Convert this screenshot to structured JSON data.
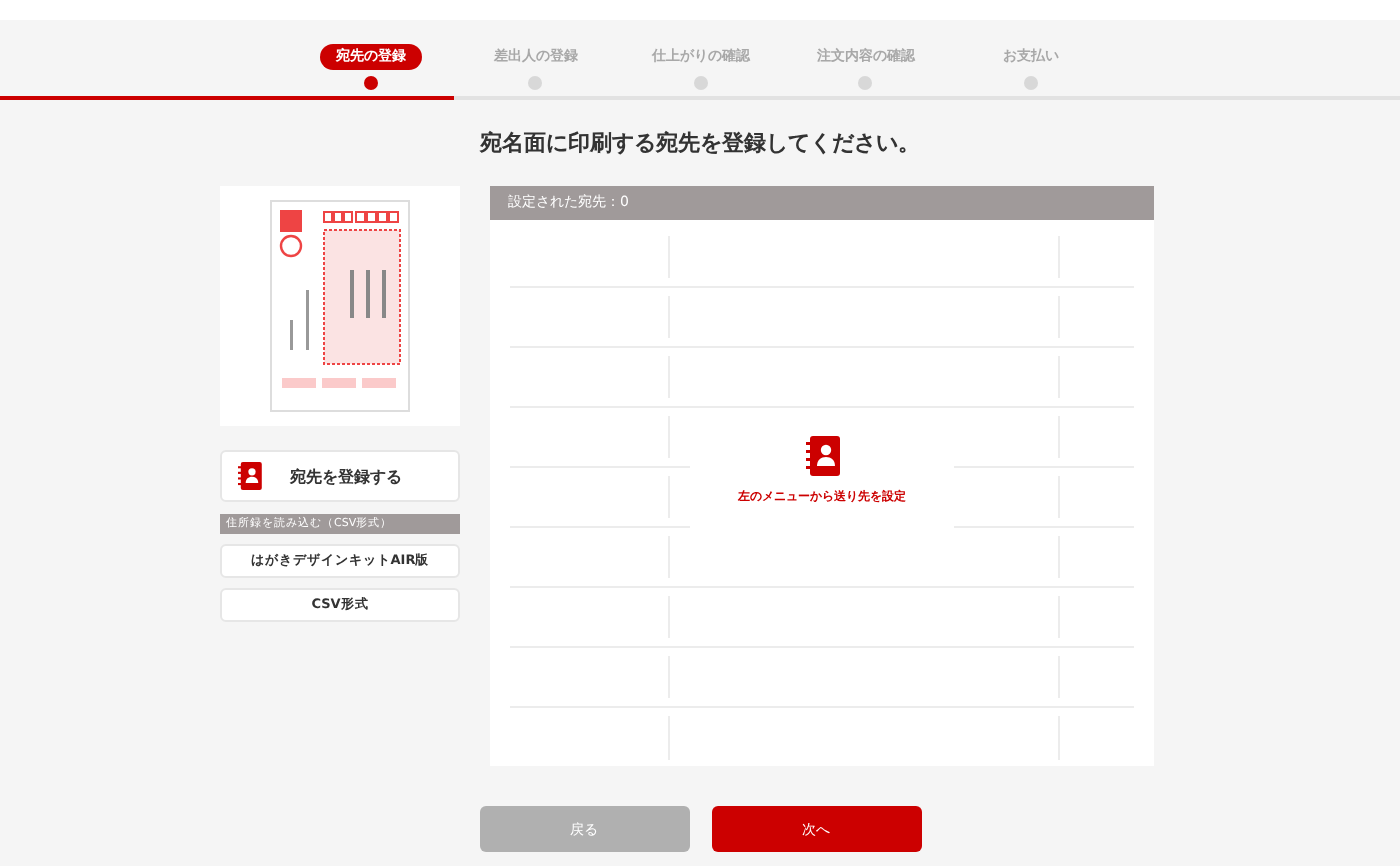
{
  "steps": [
    {
      "label": "宛先の登録",
      "selected": true
    },
    {
      "label": "差出人の登録",
      "selected": false
    },
    {
      "label": "仕上がりの確認",
      "selected": false
    },
    {
      "label": "注文内容の確認",
      "selected": false
    },
    {
      "label": "お支払い",
      "selected": false
    }
  ],
  "heading": "宛名面に印刷する宛先を登録してください。",
  "sidebar": {
    "register_button": "宛先を登録する",
    "import_label": "住所録を読み込む（CSV形式）",
    "import_buttons": [
      "はがきデザインキットAIR版",
      "CSV形式"
    ]
  },
  "panel": {
    "header": "設定された宛先：0",
    "empty_message": "左のメニューから送り先を設定"
  },
  "buttons": {
    "back": "戻る",
    "next": "次へ"
  }
}
